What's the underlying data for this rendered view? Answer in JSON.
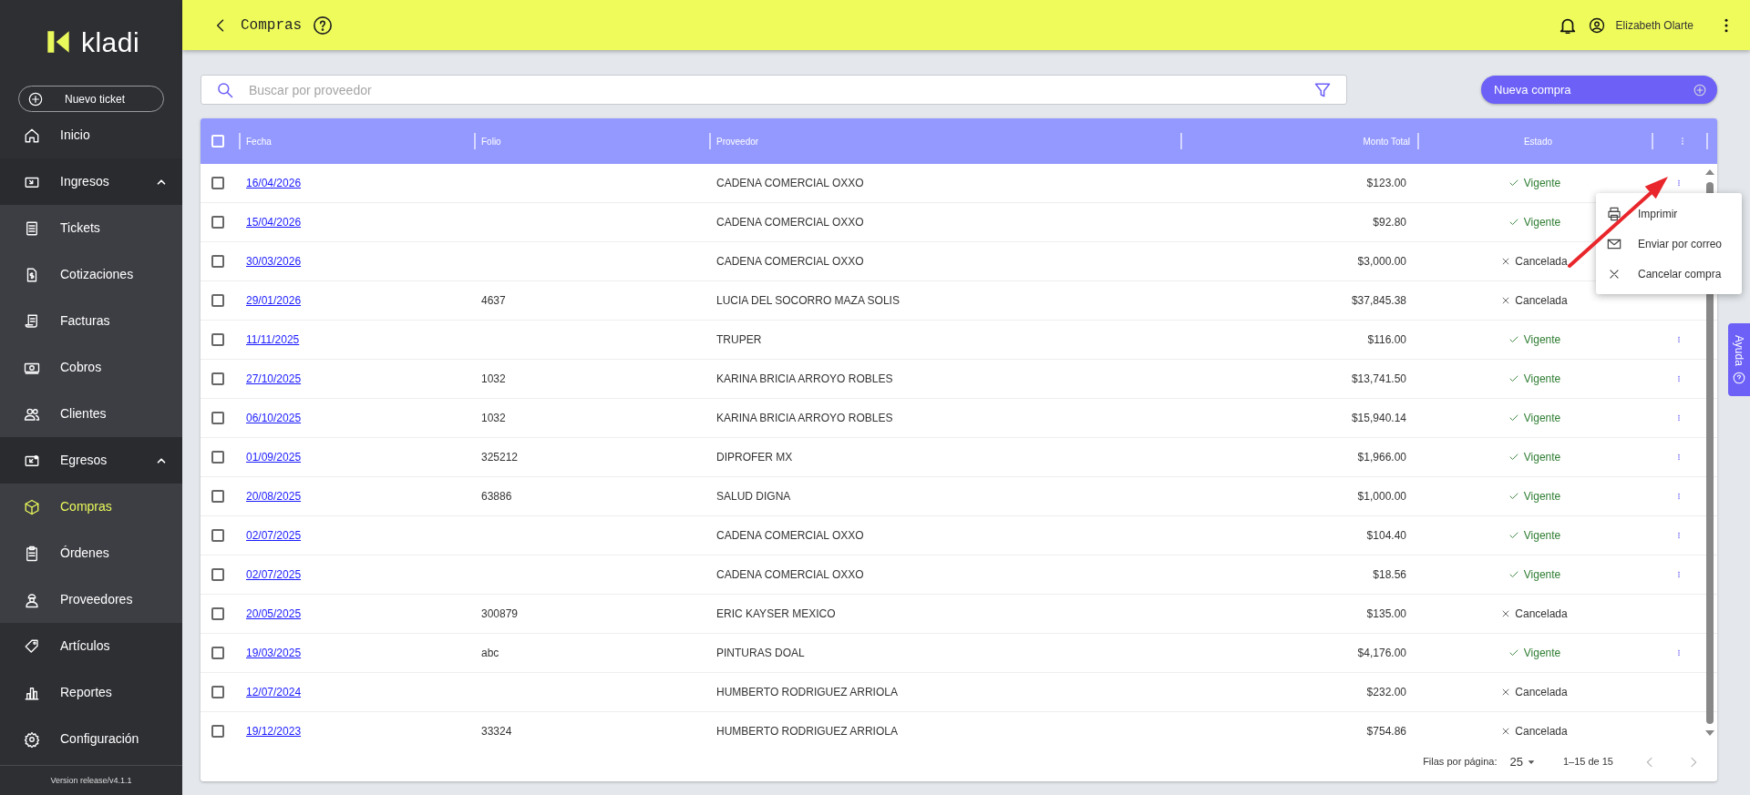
{
  "sidebar": {
    "logo": "kladi",
    "new_ticket": "Nuevo ticket",
    "items": [
      {
        "label": "Inicio",
        "selected": false
      },
      {
        "label": "Ingresos",
        "selected": false,
        "expanded": true,
        "children": [
          {
            "label": "Tickets",
            "selected": false
          },
          {
            "label": "Cotizaciones",
            "selected": false
          },
          {
            "label": "Facturas",
            "selected": false
          },
          {
            "label": "Cobros",
            "selected": false
          },
          {
            "label": "Clientes",
            "selected": false
          }
        ]
      },
      {
        "label": "Egresos",
        "selected": false,
        "expanded": true,
        "children": [
          {
            "label": "Compras",
            "selected": true
          },
          {
            "label": "Órdenes",
            "selected": false
          },
          {
            "label": "Proveedores",
            "selected": false
          }
        ]
      },
      {
        "label": "Artículos",
        "selected": false
      },
      {
        "label": "Reportes",
        "selected": false
      },
      {
        "label": "Configuración",
        "selected": false
      }
    ],
    "version": "Version release/v4.1.1"
  },
  "header": {
    "title": "Compras",
    "user": "Elizabeth Olarte"
  },
  "search": {
    "placeholder": "Buscar por proveedor"
  },
  "new_button": "Nueva compra",
  "table": {
    "all_checked": false,
    "columns": [
      "Fecha",
      "Folio",
      "Proveedor",
      "Monto Total",
      "Estado"
    ],
    "rows": [
      {
        "checked": false,
        "date": "16/04/2026",
        "folio": "",
        "provider": "CADENA COMERCIAL OXXO",
        "amount": "$123.00",
        "status": "Vigente",
        "kind": "valid",
        "actions": true
      },
      {
        "checked": false,
        "date": "15/04/2026",
        "folio": "",
        "provider": "CADENA COMERCIAL OXXO",
        "amount": "$92.80",
        "status": "Vigente",
        "kind": "valid",
        "actions": false
      },
      {
        "checked": false,
        "date": "30/03/2026",
        "folio": "",
        "provider": "CADENA COMERCIAL OXXO",
        "amount": "$3,000.00",
        "status": "Cancelada",
        "kind": "cancelled",
        "actions": false
      },
      {
        "checked": false,
        "date": "29/01/2026",
        "folio": "4637",
        "provider": "LUCIA DEL SOCORRO MAZA SOLIS",
        "amount": "$37,845.38",
        "status": "Cancelada",
        "kind": "cancelled",
        "actions": false
      },
      {
        "checked": false,
        "date": "11/11/2025",
        "folio": "",
        "provider": "TRUPER",
        "amount": "$116.00",
        "status": "Vigente",
        "kind": "valid",
        "actions": true
      },
      {
        "checked": false,
        "date": "27/10/2025",
        "folio": "1032",
        "provider": "KARINA BRICIA ARROYO ROBLES",
        "amount": "$13,741.50",
        "status": "Vigente",
        "kind": "valid",
        "actions": true
      },
      {
        "checked": false,
        "date": "06/10/2025",
        "folio": "1032",
        "provider": "KARINA BRICIA ARROYO ROBLES",
        "amount": "$15,940.14",
        "status": "Vigente",
        "kind": "valid",
        "actions": true
      },
      {
        "checked": false,
        "date": "01/09/2025",
        "folio": "325212",
        "provider": "DIPROFER MX",
        "amount": "$1,966.00",
        "status": "Vigente",
        "kind": "valid",
        "actions": true
      },
      {
        "checked": false,
        "date": "20/08/2025",
        "folio": "63886",
        "provider": "SALUD DIGNA",
        "amount": "$1,000.00",
        "status": "Vigente",
        "kind": "valid",
        "actions": true
      },
      {
        "checked": false,
        "date": "02/07/2025",
        "folio": "",
        "provider": "CADENA COMERCIAL OXXO",
        "amount": "$104.40",
        "status": "Vigente",
        "kind": "valid",
        "actions": true
      },
      {
        "checked": false,
        "date": "02/07/2025",
        "folio": "",
        "provider": "CADENA COMERCIAL OXXO",
        "amount": "$18.56",
        "status": "Vigente",
        "kind": "valid",
        "actions": true
      },
      {
        "checked": false,
        "date": "20/05/2025",
        "folio": "300879",
        "provider": "ERIC KAYSER MEXICO",
        "amount": "$135.00",
        "status": "Cancelada",
        "kind": "cancelled",
        "actions": false
      },
      {
        "checked": false,
        "date": "19/03/2025",
        "folio": "abc",
        "provider": "PINTURAS DOAL",
        "amount": "$4,176.00",
        "status": "Vigente",
        "kind": "valid",
        "actions": true
      },
      {
        "checked": false,
        "date": "12/07/2024",
        "folio": "",
        "provider": "HUMBERTO RODRIGUEZ ARRIOLA",
        "amount": "$232.00",
        "status": "Cancelada",
        "kind": "cancelled",
        "actions": false
      },
      {
        "checked": false,
        "date": "19/12/2023",
        "folio": "33324",
        "provider": "HUMBERTO RODRIGUEZ ARRIOLA",
        "amount": "$754.86",
        "status": "Cancelada",
        "kind": "cancelled",
        "actions": false
      }
    ]
  },
  "pagination": {
    "rows_label": "Filas por página:",
    "rows_value": "25",
    "range": "1–15 de 15"
  },
  "row_menu": {
    "items": [
      {
        "label": "Imprimir",
        "kind": "print"
      },
      {
        "label": "Enviar por correo",
        "kind": "mail"
      },
      {
        "label": "Cancelar compra",
        "kind": "cancel"
      }
    ]
  },
  "help_tab": "Ayuda",
  "annotation": {
    "kind": "arrow"
  }
}
